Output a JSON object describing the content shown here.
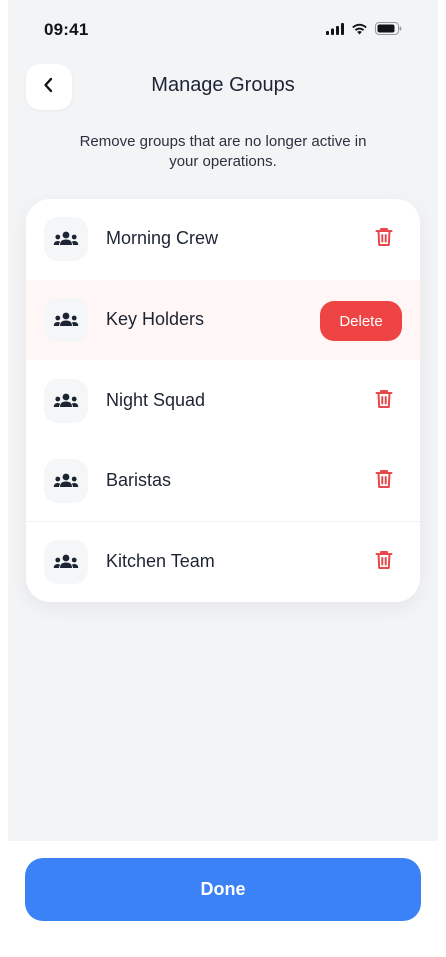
{
  "status_bar": {
    "time": "09:41"
  },
  "header": {
    "title": "Manage Groups",
    "back_icon": "chevron-left-icon"
  },
  "description": "Remove groups that are no longer active in your operations.",
  "groups": [
    {
      "name": "Morning Crew",
      "icon": "people-group-icon",
      "action": "trash-icon"
    },
    {
      "name": "Key Holders",
      "icon": "people-group-icon",
      "action": "delete-button",
      "action_label": "Delete"
    },
    {
      "name": "Night Squad",
      "icon": "people-group-icon",
      "action": "trash-icon"
    },
    {
      "name": "Baristas",
      "icon": "people-group-icon",
      "action": "trash-icon"
    },
    {
      "name": "Kitchen Team",
      "icon": "people-group-icon",
      "action": "trash-icon"
    }
  ],
  "footer": {
    "done_label": "Done"
  },
  "colors": {
    "accent_blue": "#3b82f6",
    "danger_red": "#ef4444",
    "background": "#f3f4f6",
    "card": "#ffffff",
    "highlight_row": "#fff6f5"
  }
}
